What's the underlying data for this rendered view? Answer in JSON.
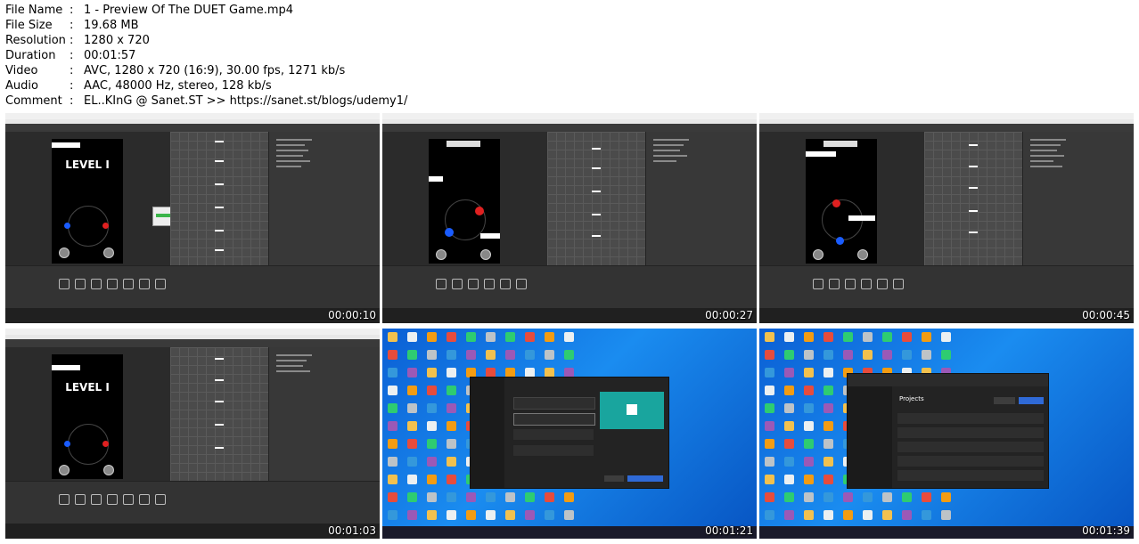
{
  "info": [
    {
      "key": "File Name",
      "value": "1 - Preview Of The DUET Game.mp4"
    },
    {
      "key": "File Size",
      "value": "19.68 MB"
    },
    {
      "key": "Resolution",
      "value": "1280 x 720"
    },
    {
      "key": "Duration",
      "value": "00:01:57"
    },
    {
      "key": "Video",
      "value": "AVC, 1280 x 720 (16:9), 30.00 fps, 1271 kb/s"
    },
    {
      "key": "Audio",
      "value": "AAC, 48000 Hz, stereo, 128 kb/s"
    },
    {
      "key": "Comment",
      "value": "EL..KInG @ Sanet.ST >> https://sanet.st/blogs/udemy1/"
    }
  ],
  "separator": ":",
  "game_level_text": "LEVEL I",
  "hub_header": "Projects",
  "thumbnails": [
    {
      "timestamp": "00:00:10",
      "scene": "unity-editor"
    },
    {
      "timestamp": "00:00:27",
      "scene": "unity-editor"
    },
    {
      "timestamp": "00:00:45",
      "scene": "unity-editor"
    },
    {
      "timestamp": "00:01:03",
      "scene": "unity-editor"
    },
    {
      "timestamp": "00:01:21",
      "scene": "unity-hub-new-project"
    },
    {
      "timestamp": "00:01:39",
      "scene": "unity-hub-projects"
    }
  ],
  "colors": {
    "red_dot": "#e02020",
    "blue_dot": "#1a5cff",
    "desktop_blue": "#0b5fd4",
    "hub_teal": "#19a59e"
  }
}
